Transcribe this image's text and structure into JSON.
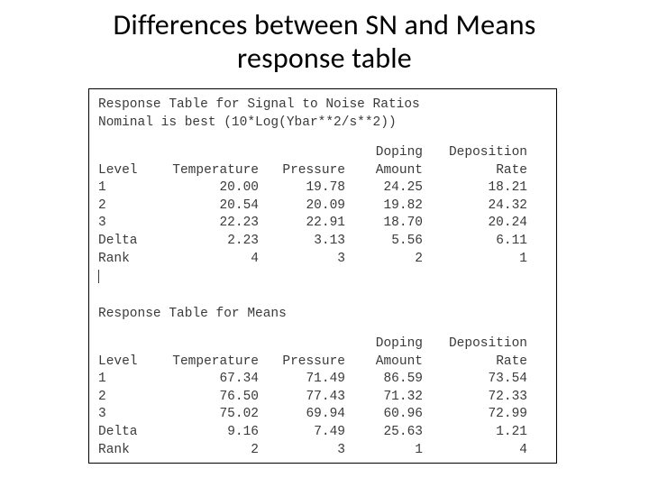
{
  "title_line1": "Differences between SN and Means",
  "title_line2": "response table",
  "sn": {
    "heading": "Response Table for Signal to Noise Ratios",
    "sub": "Nominal is best (10*Log(Ybar**2/s**2))",
    "head": {
      "level": "Level",
      "temp": "Temperature",
      "pres": "Pressure",
      "dope1": "Doping",
      "dope2": "Amount",
      "depo1": "Deposition",
      "depo2": "Rate"
    },
    "rows": [
      {
        "lv": "1",
        "temp": "20.00",
        "pres": "19.78",
        "dope": "24.25",
        "depo": "18.21"
      },
      {
        "lv": "2",
        "temp": "20.54",
        "pres": "20.09",
        "dope": "19.82",
        "depo": "24.32"
      },
      {
        "lv": "3",
        "temp": "22.23",
        "pres": "22.91",
        "dope": "18.70",
        "depo": "20.24"
      },
      {
        "lv": "Delta",
        "temp": "2.23",
        "pres": "3.13",
        "dope": "5.56",
        "depo": "6.11"
      },
      {
        "lv": "Rank",
        "temp": "4",
        "pres": "3",
        "dope": "2",
        "depo": "1"
      }
    ]
  },
  "means": {
    "heading": "Response Table for Means",
    "head": {
      "level": "Level",
      "temp": "Temperature",
      "pres": "Pressure",
      "dope1": "Doping",
      "dope2": "Amount",
      "depo1": "Deposition",
      "depo2": "Rate"
    },
    "rows": [
      {
        "lv": "1",
        "temp": "67.34",
        "pres": "71.49",
        "dope": "86.59",
        "depo": "73.54"
      },
      {
        "lv": "2",
        "temp": "76.50",
        "pres": "77.43",
        "dope": "71.32",
        "depo": "72.33"
      },
      {
        "lv": "3",
        "temp": "75.02",
        "pres": "69.94",
        "dope": "60.96",
        "depo": "72.99"
      },
      {
        "lv": "Delta",
        "temp": "9.16",
        "pres": "7.49",
        "dope": "25.63",
        "depo": "1.21"
      },
      {
        "lv": "Rank",
        "temp": "2",
        "pres": "3",
        "dope": "1",
        "depo": "4"
      }
    ]
  },
  "chart_data": [
    {
      "type": "table",
      "title": "Response Table for Signal to Noise Ratios — Nominal is best (10*Log(Ybar**2/s**2))",
      "columns": [
        "Level",
        "Temperature",
        "Pressure",
        "Doping Amount",
        "Deposition Rate"
      ],
      "rows": [
        [
          "1",
          20.0,
          19.78,
          24.25,
          18.21
        ],
        [
          "2",
          20.54,
          20.09,
          19.82,
          24.32
        ],
        [
          "3",
          22.23,
          22.91,
          18.7,
          20.24
        ],
        [
          "Delta",
          2.23,
          3.13,
          5.56,
          6.11
        ],
        [
          "Rank",
          4,
          3,
          2,
          1
        ]
      ]
    },
    {
      "type": "table",
      "title": "Response Table for Means",
      "columns": [
        "Level",
        "Temperature",
        "Pressure",
        "Doping Amount",
        "Deposition Rate"
      ],
      "rows": [
        [
          "1",
          67.34,
          71.49,
          86.59,
          73.54
        ],
        [
          "2",
          76.5,
          77.43,
          71.32,
          72.33
        ],
        [
          "3",
          75.02,
          69.94,
          60.96,
          72.99
        ],
        [
          "Delta",
          9.16,
          7.49,
          25.63,
          1.21
        ],
        [
          "Rank",
          2,
          3,
          1,
          4
        ]
      ]
    }
  ]
}
